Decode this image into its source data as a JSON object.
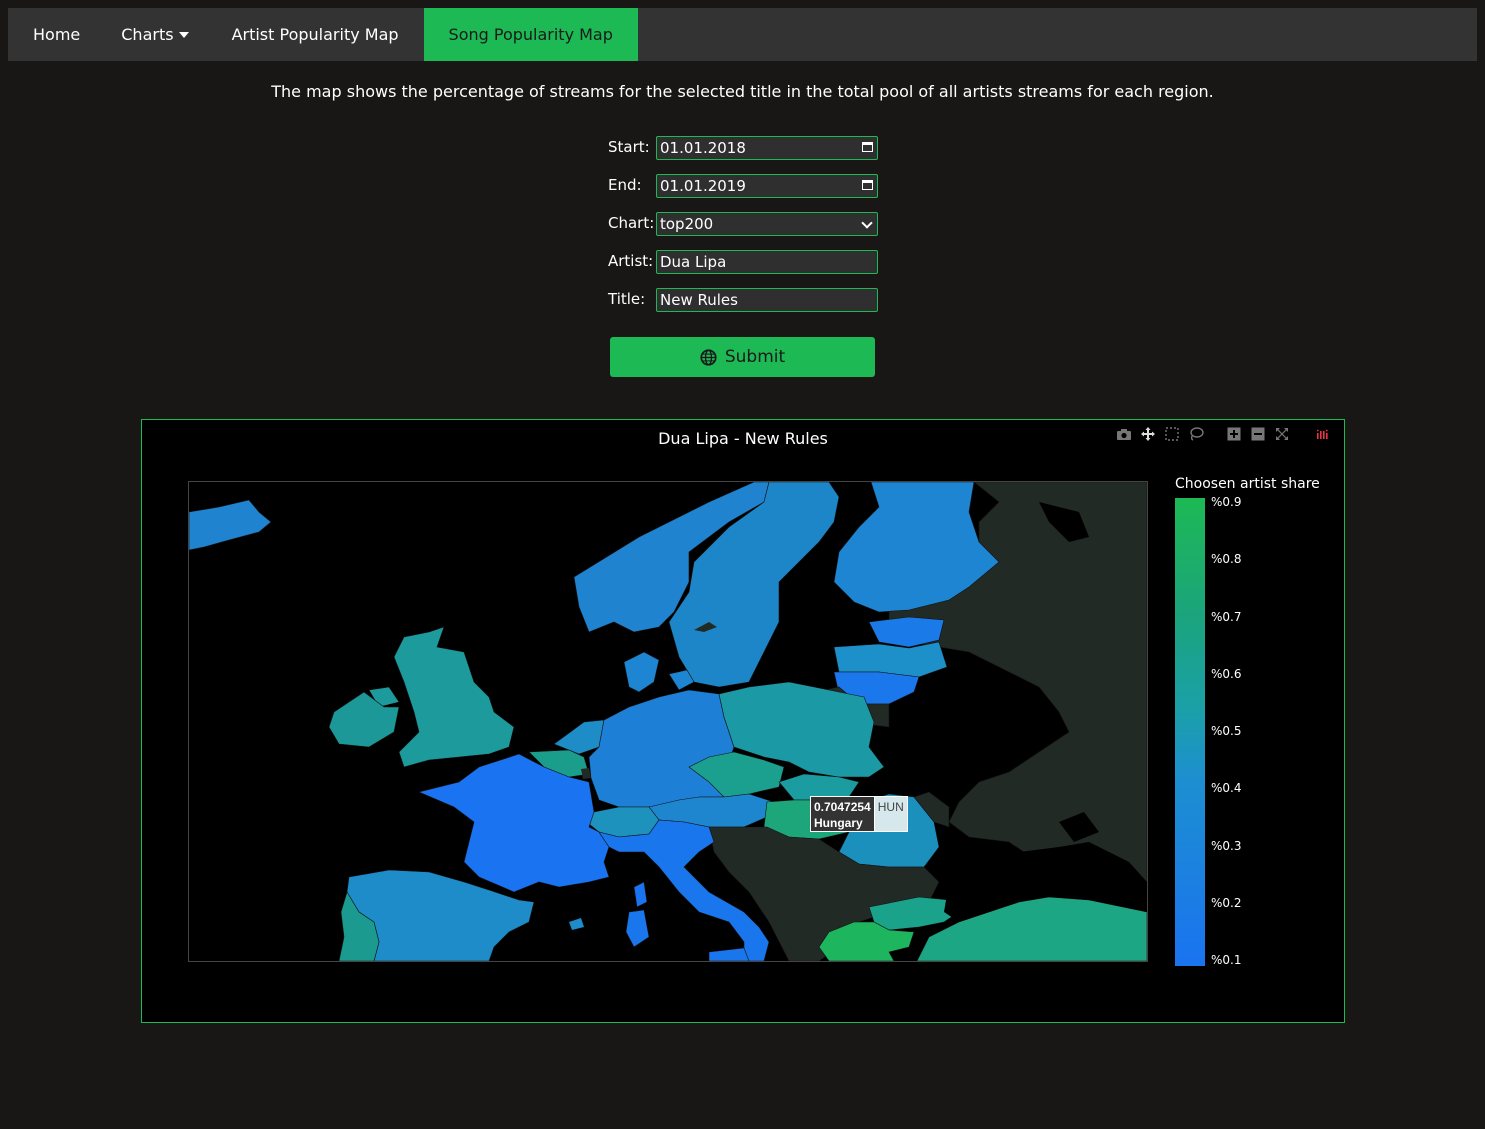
{
  "nav": {
    "home": "Home",
    "charts": "Charts",
    "artist_map": "Artist Popularity Map",
    "song_map": "Song Popularity Map"
  },
  "description": "The map shows the percentage of streams for the selected title in the total pool of all artists streams for each region.",
  "form": {
    "start_label": "Start:",
    "start_value": "01.01.2018",
    "end_label": "End:",
    "end_value": "01.01.2019",
    "chart_label": "Chart:",
    "chart_value": "top200",
    "artist_label": "Artist:",
    "artist_value": "Dua Lipa",
    "title_label": "Title:",
    "title_value": "New Rules",
    "submit_label": "Submit"
  },
  "map": {
    "title": "Dua Lipa - New Rules",
    "colorbar_title": "Choosen artist share",
    "ticks": [
      "%0.9",
      "%0.8",
      "%0.7",
      "%0.6",
      "%0.5",
      "%0.4",
      "%0.3",
      "%0.2",
      "%0.1"
    ],
    "tooltip": {
      "value": "0.7047254",
      "country": "Hungary",
      "code": "HUN"
    }
  },
  "colors": {
    "accent": "#1db954",
    "background": "#181716",
    "no_data": "#222a26"
  }
}
